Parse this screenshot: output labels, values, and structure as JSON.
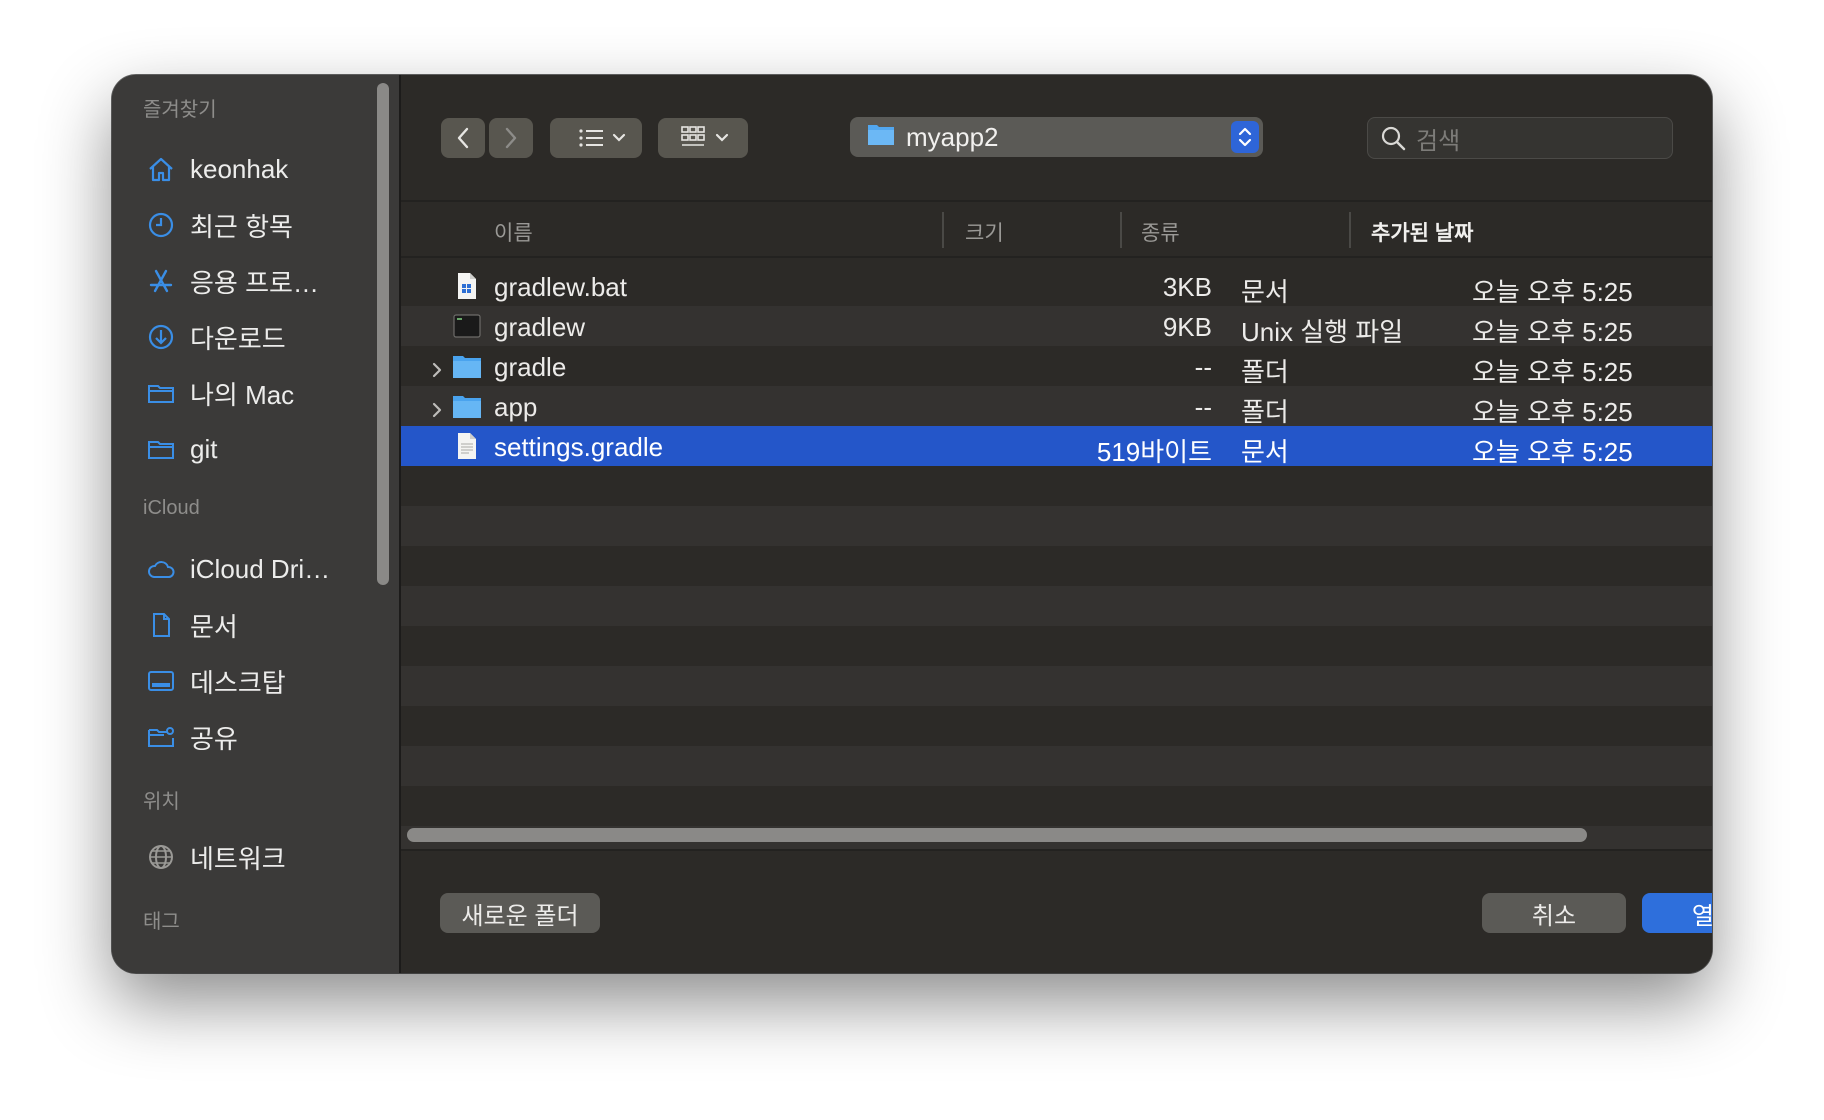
{
  "sidebar": {
    "sections": {
      "favorites": "즐겨찾기",
      "icloud": "iCloud",
      "locations": "위치",
      "tags": "태그"
    },
    "favorites": [
      {
        "label": "keonhak",
        "icon": "house-icon"
      },
      {
        "label": "최근 항목",
        "icon": "clock-icon"
      },
      {
        "label": "응용 프로…",
        "icon": "apps-icon"
      },
      {
        "label": "다운로드",
        "icon": "download-icon"
      },
      {
        "label": "나의 Mac",
        "icon": "folder-icon"
      },
      {
        "label": "git",
        "icon": "folder-icon"
      }
    ],
    "icloud": [
      {
        "label": "iCloud Dri…",
        "icon": "cloud-icon"
      },
      {
        "label": "문서",
        "icon": "document-icon"
      },
      {
        "label": "데스크탑",
        "icon": "desktop-icon"
      },
      {
        "label": "공유",
        "icon": "shared-folder-icon"
      }
    ],
    "locations": [
      {
        "label": "네트워크",
        "icon": "network-icon"
      }
    ]
  },
  "toolbar": {
    "path": "myapp2",
    "search_placeholder": "검색"
  },
  "columns": {
    "name": "이름",
    "size": "크기",
    "kind": "종류",
    "date": "추가된 날짜"
  },
  "files": [
    {
      "name": "gradlew.bat",
      "size": "3KB",
      "kind": "문서",
      "date": "오늘 오후 5:25",
      "icon": "windows-doc-icon",
      "expandable": false
    },
    {
      "name": "gradlew",
      "size": "9KB",
      "kind": "Unix 실행 파일",
      "date": "오늘 오후 5:25",
      "icon": "terminal-exec-icon",
      "expandable": false
    },
    {
      "name": "gradle",
      "size": "--",
      "kind": "폴더",
      "date": "오늘 오후 5:25",
      "icon": "folder-icon",
      "expandable": true
    },
    {
      "name": "app",
      "size": "--",
      "kind": "폴더",
      "date": "오늘 오후 5:25",
      "icon": "folder-icon",
      "expandable": true
    },
    {
      "name": "settings.gradle",
      "size": "519바이트",
      "kind": "문서",
      "date": "오늘 오후 5:25",
      "icon": "text-doc-icon",
      "expandable": false,
      "selected": true
    }
  ],
  "buttons": {
    "new_folder": "새로운 폴더",
    "cancel": "취소",
    "open": "열기"
  },
  "colors": {
    "selection": "#2456c9",
    "accent": "#2e6fdc"
  }
}
